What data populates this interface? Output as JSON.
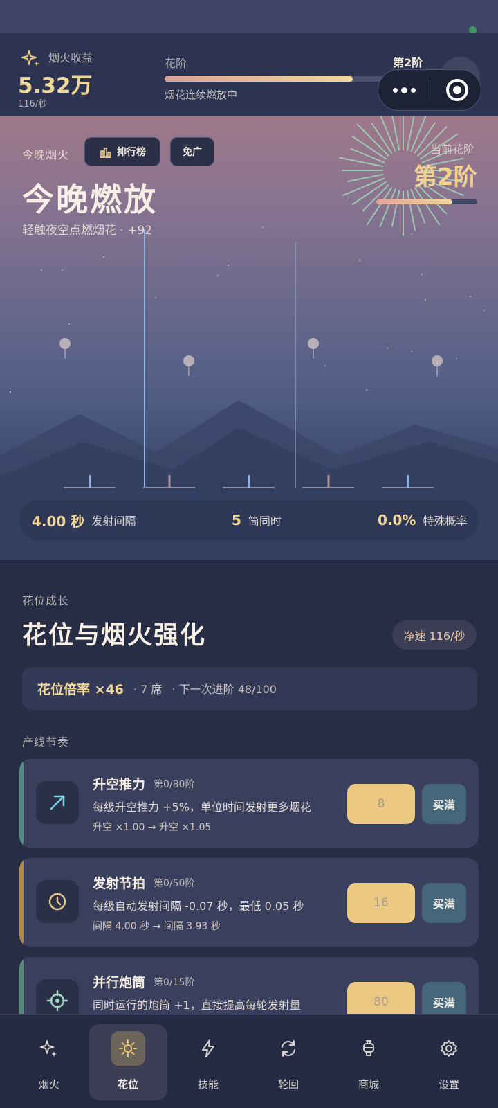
{
  "top": {
    "income_label": "烟火收益",
    "income_value": "5.32万",
    "income_rate": "116/秒",
    "stage_label": "花阶",
    "stage_value": "第2阶",
    "stage_progress": 0.8,
    "status_text": "烟花连续燃放中"
  },
  "night": {
    "label": "今晚烟火",
    "rank_button": "排行榜",
    "adfree_button": "免广",
    "title": "今晚燃放",
    "subtitle": "轻触夜空点燃烟花 · +92",
    "stage_caption": "当前花阶",
    "stage_value": "第2阶",
    "stage_progress": 0.75,
    "stats": [
      {
        "value": "4.00 秒",
        "label": "发射间隔"
      },
      {
        "value": "5",
        "label": "筒同时"
      },
      {
        "value": "0.0%",
        "label": "特殊概率"
      }
    ]
  },
  "growth": {
    "kicker": "花位成长",
    "title": "花位与烟火强化",
    "speed_chip": "净速 116/秒",
    "multiplier": "花位倍率 ×46",
    "seats": "· 7 席",
    "next": "· 下一次进阶 48/100",
    "line_label": "产线节奏"
  },
  "upgrades": [
    {
      "name": "升空推力",
      "level": "第0/80阶",
      "desc": "每级升空推力 +5%，单位时间发射更多烟花",
      "delta": "升空 ×1.00 → 升空 ×1.05",
      "cost": "8",
      "max_label": "买满",
      "icon": "arrow-up-right-icon",
      "accent": "#4f8f86"
    },
    {
      "name": "发射节拍",
      "level": "第0/50阶",
      "desc": "每级自动发射间隔 -0.07 秒，最低 0.05 秒",
      "delta": "间隔 4.00 秒 → 间隔 3.93 秒",
      "cost": "16",
      "max_label": "买满",
      "icon": "clock-icon",
      "accent": "#b08a44"
    },
    {
      "name": "并行炮筒",
      "level": "第0/15阶",
      "desc": "同时运行的炮筒 +1，直接提高每轮发射量",
      "delta": "",
      "cost": "80",
      "max_label": "买满",
      "icon": "crosshair-icon",
      "accent": "#4f8f6e"
    }
  ],
  "tabs": [
    {
      "label": "烟火",
      "icon": "sparkle-icon"
    },
    {
      "label": "花位",
      "icon": "sun-icon"
    },
    {
      "label": "技能",
      "icon": "lightning-icon"
    },
    {
      "label": "轮回",
      "icon": "cycle-icon"
    },
    {
      "label": "商城",
      "icon": "lantern-icon"
    },
    {
      "label": "设置",
      "icon": "gear-icon"
    }
  ],
  "colors": {
    "accent_gold": "#f1d79a",
    "buy_button": "#ecc983",
    "max_button": "#46677a"
  }
}
